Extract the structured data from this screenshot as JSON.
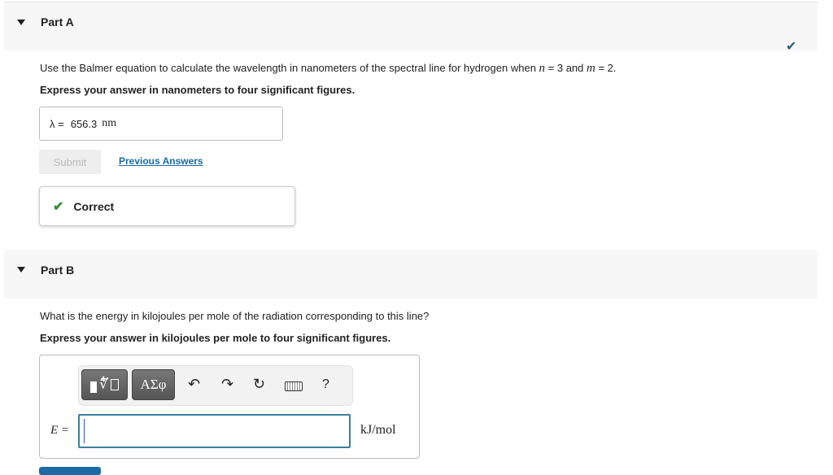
{
  "partA": {
    "title": "Part A",
    "question_pre": "Use the Balmer equation to calculate the wavelength in nanometers of the spectral line for hydrogen when ",
    "n_var": "n",
    "n_eq": " = 3 and ",
    "m_var": "m",
    "m_eq": " = 2.",
    "instruction": "Express your answer in nanometers to four significant figures.",
    "answer_label": "λ =",
    "answer_value": "656.3",
    "answer_unit": "nm",
    "submit_label": "Submit",
    "previous_answers_label": "Previous Answers",
    "feedback": "Correct",
    "status": "complete"
  },
  "partB": {
    "title": "Part B",
    "question": "What is the energy in kilojoules per mole of the radiation corresponding to this line?",
    "instruction": "Express your answer in kilojoules per mole to four significant figures.",
    "toolbar": {
      "greek_label": "ΑΣφ",
      "help_label": "?"
    },
    "answer_label": "E =",
    "answer_value": "",
    "answer_unit": "kJ/mol"
  },
  "colors": {
    "correct": "#3c8c3c",
    "link": "#1a6aa6",
    "complete_check": "#2b5f7a"
  }
}
